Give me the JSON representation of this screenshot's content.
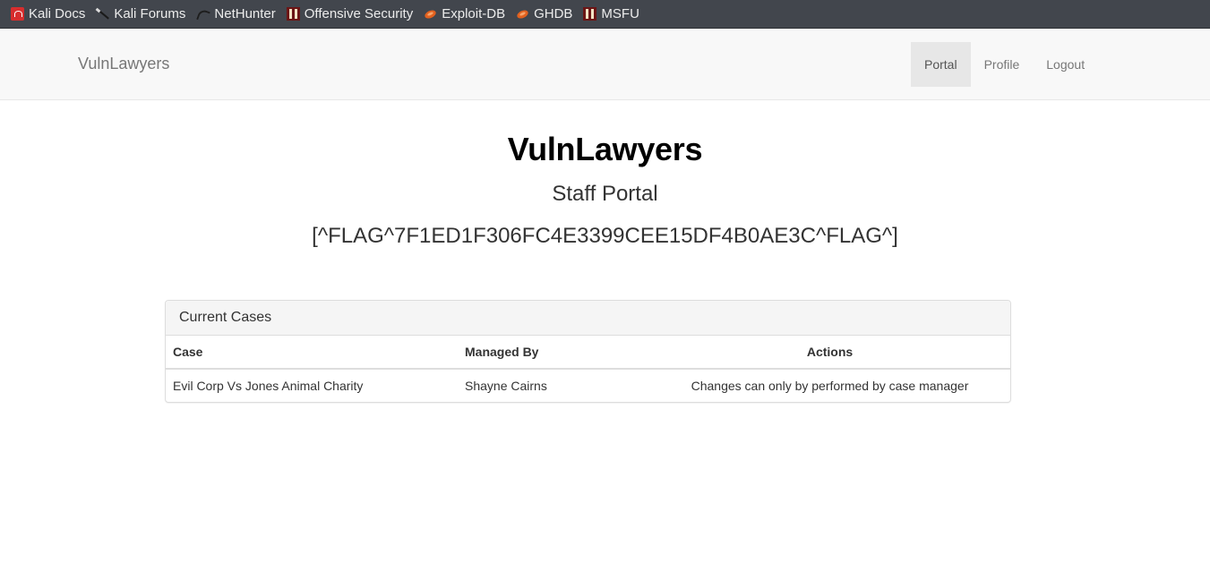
{
  "bookmarks": [
    {
      "label": "Kali Docs",
      "icon": "kali-docs-icon"
    },
    {
      "label": "Kali Forums",
      "icon": "kali-forums-icon"
    },
    {
      "label": "NetHunter",
      "icon": "nethunter-icon"
    },
    {
      "label": "Offensive Security",
      "icon": "offensive-security-icon"
    },
    {
      "label": "Exploit-DB",
      "icon": "exploit-db-icon"
    },
    {
      "label": "GHDB",
      "icon": "ghdb-icon"
    },
    {
      "label": "MSFU",
      "icon": "msfu-icon"
    }
  ],
  "navbar": {
    "brand": "VulnLawyers",
    "links": [
      "Portal",
      "Profile",
      "Logout"
    ],
    "active": "Portal"
  },
  "hero": {
    "title": "VulnLawyers",
    "subtitle": "Staff Portal",
    "flag": "[^FLAG^7F1ED1F306FC4E3399CEE15DF4B0AE3C^FLAG^]"
  },
  "cases": {
    "heading": "Current Cases",
    "columns": [
      "Case",
      "Managed By",
      "Actions"
    ],
    "rows": [
      {
        "case": "Evil Corp Vs Jones Animal Charity",
        "managed_by": "Shayne Cairns",
        "actions": "Changes can only by performed by case manager"
      }
    ]
  }
}
